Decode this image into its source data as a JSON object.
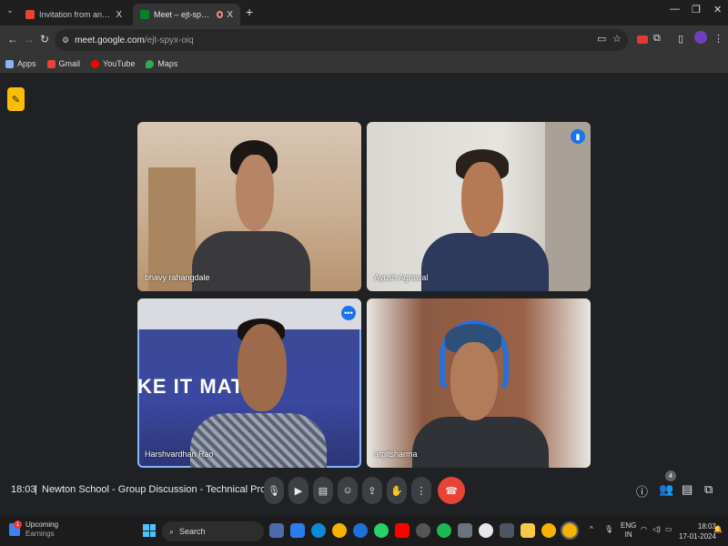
{
  "browser": {
    "tabs": [
      {
        "title": "Invitation from an unknown sen",
        "favicon": "gmail-icon",
        "close": "X",
        "active": false
      },
      {
        "title": "Meet – ejt-spyx-oiq",
        "favicon": "meet-icon",
        "close": "X",
        "active": true
      }
    ],
    "new_tab": "+",
    "url_host": "meet.google.com",
    "url_path": "/ejt-spyx-oiq",
    "bookmarks": [
      {
        "label": "Apps",
        "icon": "apps-grid-icon",
        "color": "#8ab4f8"
      },
      {
        "label": "Gmail",
        "icon": "gmail-icon",
        "color": "#ea4335"
      },
      {
        "label": "YouTube",
        "icon": "youtube-icon",
        "color": "#ff0000"
      },
      {
        "label": "Maps",
        "icon": "maps-icon",
        "color": "#34a853"
      }
    ]
  },
  "meet": {
    "participants": [
      {
        "name": "bhavy rahangdale"
      },
      {
        "name": "Ayush Agrawal"
      },
      {
        "name": "Harshvardhan Rao"
      },
      {
        "name": "arpitsharma"
      }
    ],
    "wall_text": "KE IT MATTE",
    "time": "18:03",
    "separator": "|",
    "meeting_title": "Newton School - Group Discussion - Technical Prog...",
    "people_count": "4",
    "accent_color": "#8ab4f8",
    "end_call_color": "#ea4335"
  },
  "taskbar": {
    "weather_title": "Upcoming",
    "weather_sub": "Earnings",
    "weather_badge": "1",
    "search_label": "Search",
    "lang_1": "ENG",
    "lang_2": "IN",
    "clock_time": "18:03",
    "clock_date": "17-01-2024"
  }
}
